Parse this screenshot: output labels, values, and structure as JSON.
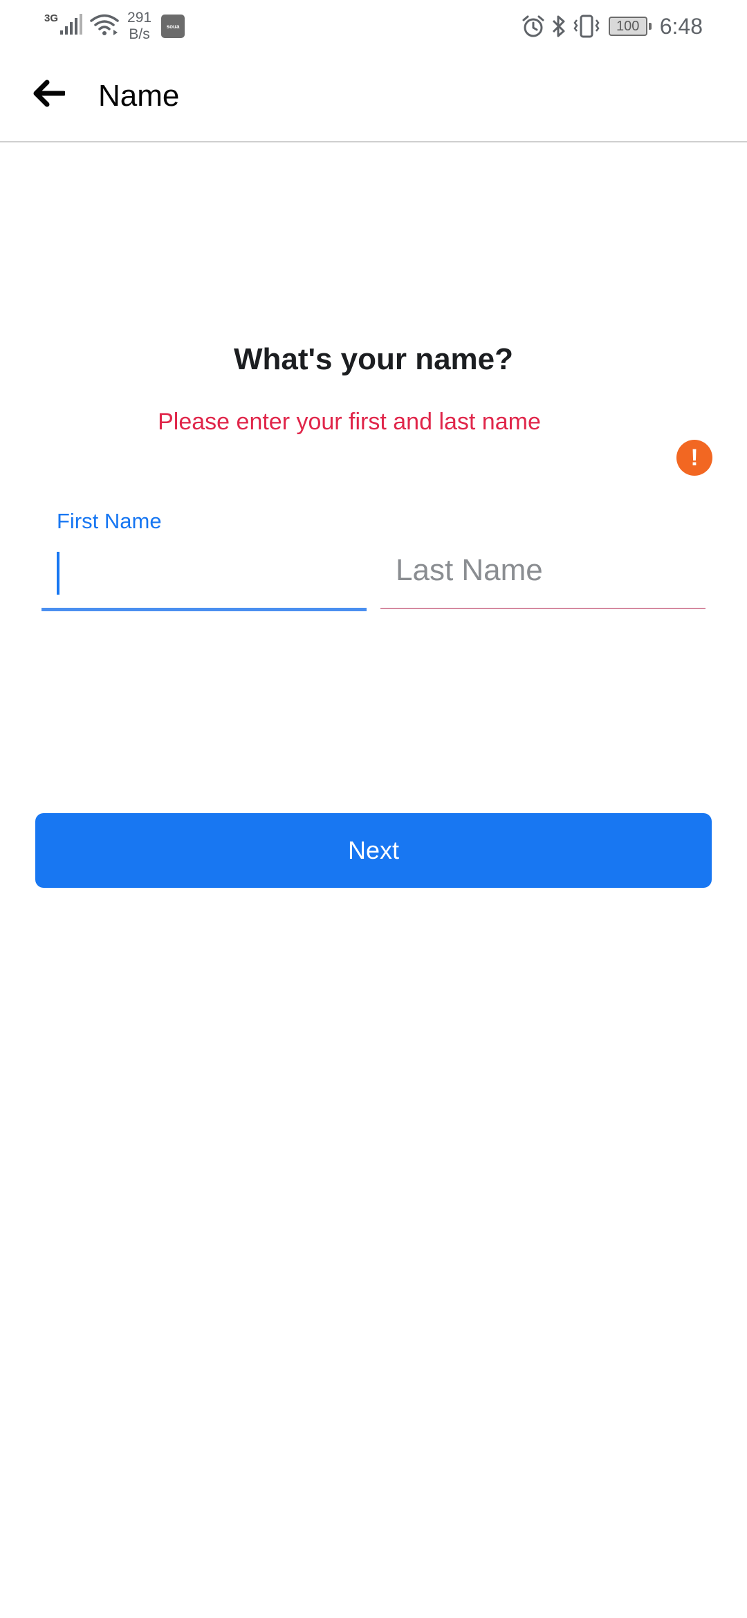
{
  "status_bar": {
    "network_type": "3G",
    "speed_value": "291",
    "speed_unit": "B/s",
    "app_icon_text": "soua",
    "battery_level": "100",
    "time": "6:48",
    "icons": [
      "signal-icon",
      "wifi-icon",
      "alarm-icon",
      "bluetooth-icon",
      "vibrate-icon",
      "battery-icon"
    ]
  },
  "app_bar": {
    "back_icon": "arrow-left-icon",
    "title": "Name"
  },
  "main": {
    "question": "What's your name?",
    "error_message": "Please enter your first and last name",
    "error_icon_glyph": "!",
    "first_name": {
      "label": "First Name",
      "value": ""
    },
    "last_name": {
      "placeholder": "Last Name",
      "value": ""
    },
    "next_label": "Next"
  },
  "colors": {
    "accent": "#1877f2",
    "error_text": "#e0264a",
    "error_icon": "#f26722",
    "heading": "#1c1e21",
    "placeholder": "#8a8d91"
  }
}
